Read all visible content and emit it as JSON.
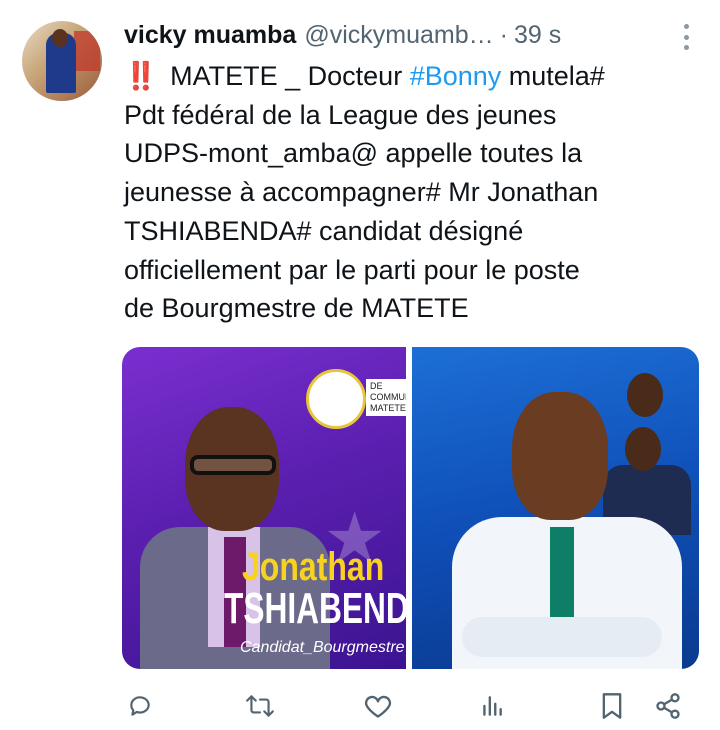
{
  "tweet": {
    "author_name": "vicky muamba",
    "author_handle": "@vickymuamb…",
    "separator": "·",
    "timestamp": "39 s",
    "text_lines": [
      {
        "prefix": "‼️",
        "before": " MATETE _ Docteur ",
        "hashtag": "#Bonny",
        "after": " mutela#"
      },
      "Pdt fédéral de la League des jeunes",
      "UDPS-mont_amba@ appelle toutes la",
      "jeunesse à accompagner# Mr Jonathan",
      "TSHIABENDA# candidat désigné",
      "officiellement par le parti pour le poste",
      "de Bourgmestre de MATETE"
    ]
  },
  "media": {
    "image1": {
      "name_line1": "Jonathan",
      "name_line2": "TSHIABENDA",
      "caption": "Candidat_Bourgmestre",
      "logo_text": "DE COMMUNE MATETE"
    }
  },
  "actions": {
    "reply": "reply-icon",
    "retweet": "retweet-icon",
    "like": "heart-icon",
    "views": "analytics-icon",
    "bookmark": "bookmark-icon",
    "share": "share-icon"
  },
  "colors": {
    "hashtag": "#1d9bf0",
    "secondary_text": "#536471",
    "alert": "#e0245e"
  }
}
